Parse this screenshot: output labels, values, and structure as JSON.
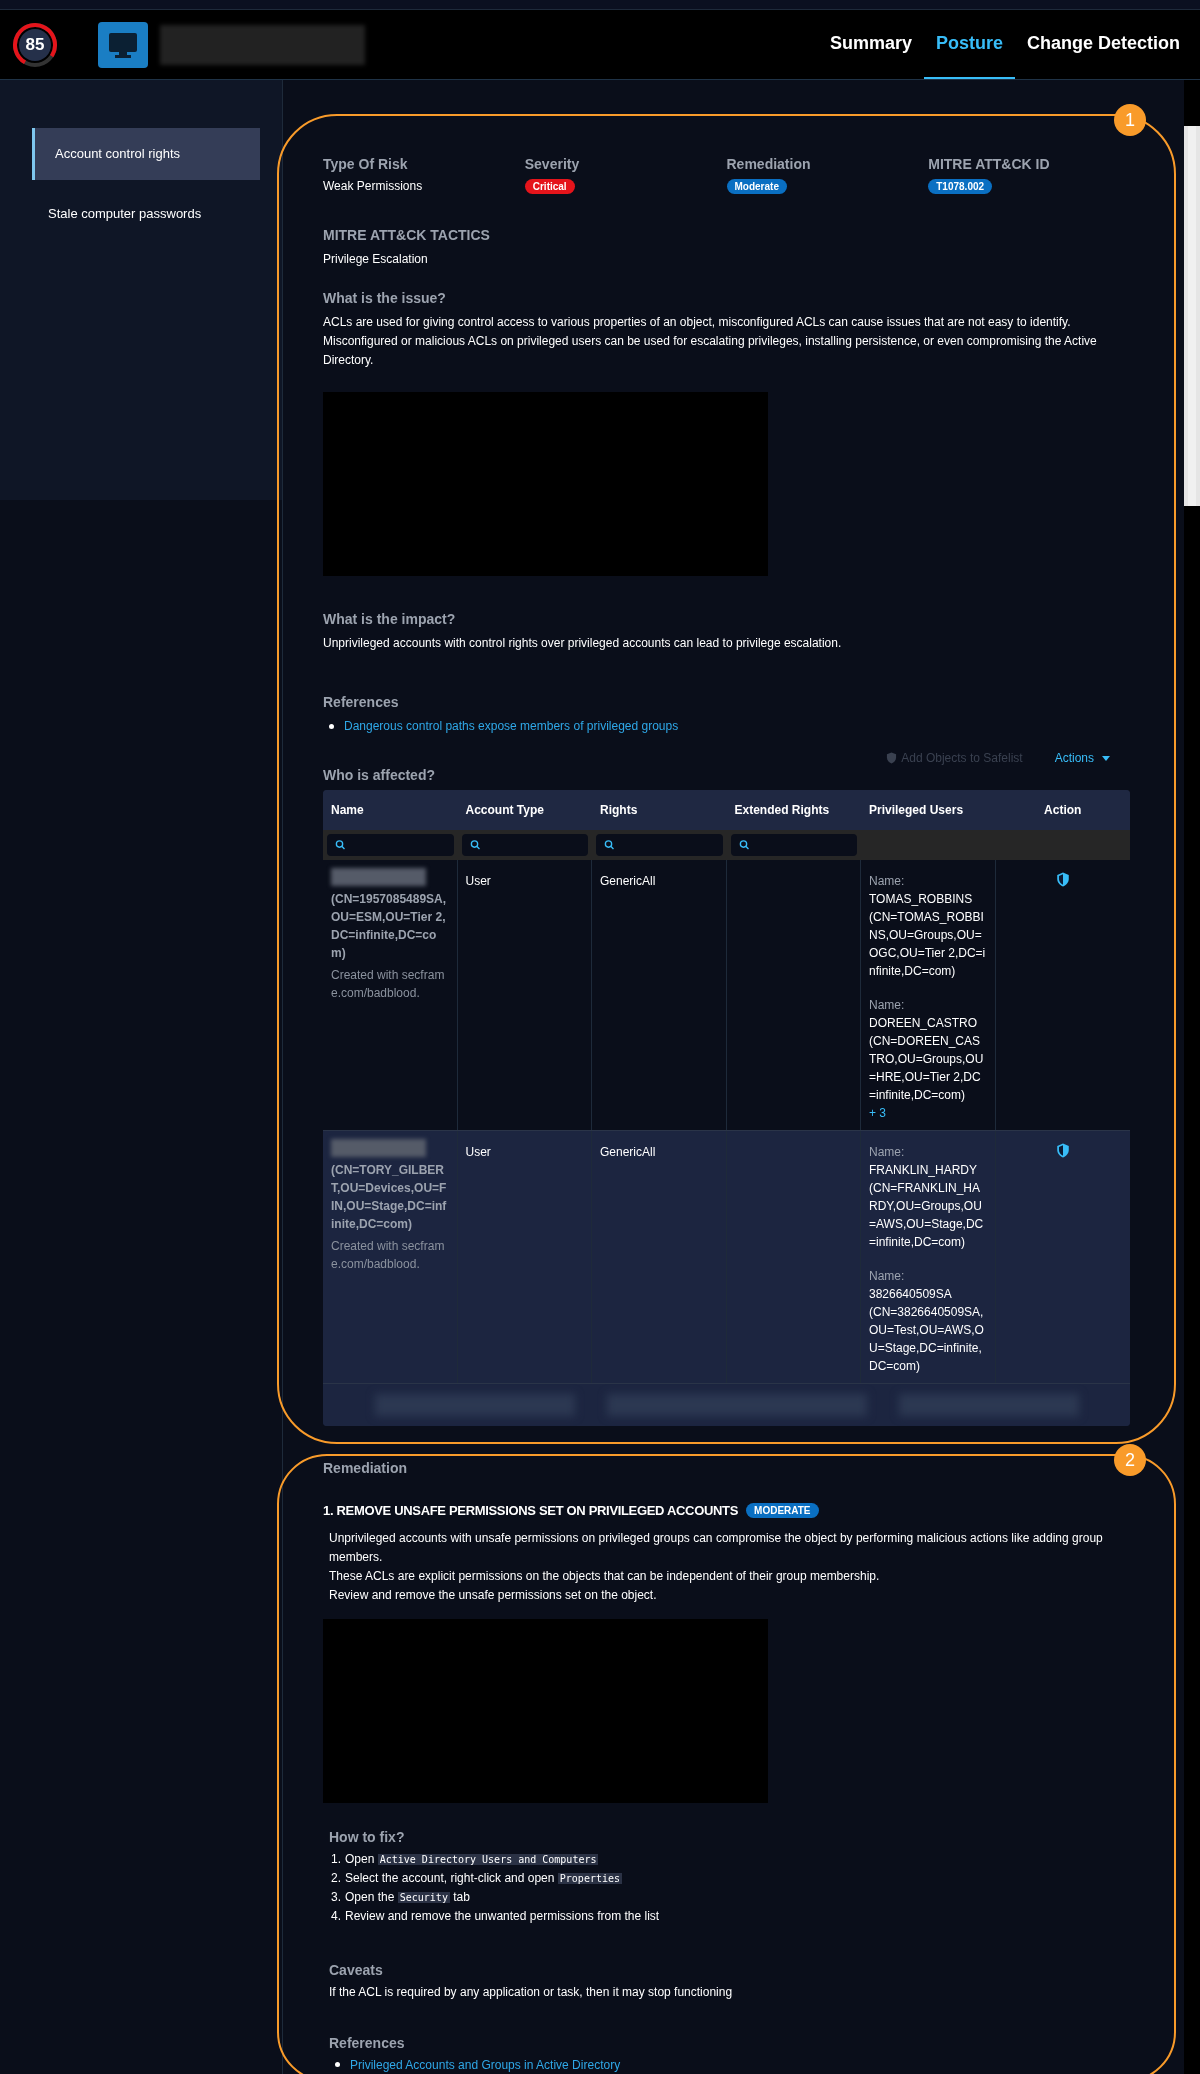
{
  "header": {
    "score": "85",
    "tabs": [
      {
        "label": "Summary",
        "selected": false
      },
      {
        "label": "Posture",
        "selected": true
      },
      {
        "label": "Change Detection",
        "selected": false
      }
    ]
  },
  "sidebar": {
    "items": [
      {
        "label": "Account control rights",
        "selected": true
      },
      {
        "label": "Stale computer passwords",
        "selected": false
      }
    ]
  },
  "annotations": [
    "1",
    "2"
  ],
  "risk": {
    "fields": [
      {
        "label": "Type Of Risk",
        "value": "Weak Permissions",
        "kind": "text"
      },
      {
        "label": "Severity",
        "value": "Critical",
        "kind": "badge",
        "color": "#e5141b"
      },
      {
        "label": "Remediation",
        "value": "Moderate",
        "kind": "badge",
        "color": "#0a6fc2"
      },
      {
        "label": "MITRE ATT&CK ID",
        "value": "T1078.002",
        "kind": "badge",
        "color": "#0a6fc2"
      }
    ],
    "tactics_label": "MITRE ATT&CK TACTICS",
    "tactics": "Privilege Escalation",
    "issue_heading": "What is the issue?",
    "issue_text": [
      "ACLs are used for giving control access to various properties of an object, misconfigured ACLs can cause issues that are not easy to identify.",
      "Misconfigured or malicious ACLs on privileged users can be used for escalating privileges, installing persistence, or even compromising the Active Directory."
    ],
    "impact_heading": "What is the impact?",
    "impact_text": "Unprivileged accounts with control rights over privileged accounts can lead to privilege escalation.",
    "references_heading": "References",
    "references": [
      "Dangerous control paths expose members of privileged groups"
    ]
  },
  "affected": {
    "safelist_button": {
      "label": "Add Objects to Safelist",
      "disabled": true
    },
    "actions_button": "Actions",
    "heading": "Who is affected?",
    "columns": [
      {
        "label": "Name",
        "filter": true
      },
      {
        "label": "Account Type",
        "filter": true
      },
      {
        "label": "Rights",
        "filter": true
      },
      {
        "label": "Extended Rights",
        "filter": true
      },
      {
        "label": "Privileged Users",
        "filter": false
      },
      {
        "label": "Action",
        "filter": false
      }
    ],
    "rows": [
      {
        "selected": false,
        "dn": "(CN=1957085489SA,OU=ESM,OU=Tier 2,DC=infinite,DC=com)",
        "note": "Created with secframe.com/badblood.",
        "account_type": "User",
        "rights": "GenericAll",
        "privileged_users": [
          {
            "label": "Name:",
            "name": "TOMAS_ROBBINS",
            "dn": "(CN=TOMAS_ROBBINS,OU=Groups,OU=OGC,OU=Tier 2,DC=infinite,DC=com)"
          },
          {
            "label": "Name:",
            "name": "DOREEN_CASTRO",
            "dn": "(CN=DOREEN_CASTRO,OU=Groups,OU=HRE,OU=Tier 2,DC=infinite,DC=com)"
          }
        ],
        "more": "+ 3"
      },
      {
        "selected": true,
        "dn": "(CN=TORY_GILBERT,OU=Devices,OU=FIN,OU=Stage,DC=infinite,DC=com)",
        "note": "Created with secframe.com/badblood.",
        "account_type": "User",
        "rights": "GenericAll",
        "privileged_users": [
          {
            "label": "Name:",
            "name": "FRANKLIN_HARDY",
            "dn": "(CN=FRANKLIN_HARDY,OU=Groups,OU=AWS,OU=Stage,DC=infinite,DC=com)"
          },
          {
            "label": "Name:",
            "name": "3826640509SA",
            "dn": "(CN=3826640509SA,OU=Test,OU=AWS,OU=Stage,DC=infinite,DC=com)"
          }
        ]
      }
    ]
  },
  "remediation": {
    "heading": "Remediation",
    "title": "1. REMOVE UNSAFE PERMISSIONS SET ON PRIVILEGED ACCOUNTS",
    "badge": "MODERATE",
    "paragraphs": [
      "Unprivileged accounts with unsafe permissions on privileged groups can compromise the object by performing malicious actions like adding group members.",
      "These ACLs are explicit permissions on the objects that can be independent of their group membership.",
      "Review and remove the unsafe permissions set on the object."
    ],
    "how_heading": "How to fix?",
    "steps": [
      {
        "number": "1.",
        "parts": [
          {
            "kind": "text",
            "text": "Open "
          },
          {
            "kind": "code",
            "text": "Active Directory Users and Computers"
          }
        ]
      },
      {
        "number": "2.",
        "parts": [
          {
            "kind": "text",
            "text": "Select the account, right-click and open "
          },
          {
            "kind": "code",
            "text": "Properties"
          }
        ]
      },
      {
        "number": "3.",
        "parts": [
          {
            "kind": "text",
            "text": "Open the "
          },
          {
            "kind": "code",
            "text": "Security"
          },
          {
            "kind": "text",
            "text": " tab"
          }
        ]
      },
      {
        "number": "4.",
        "parts": [
          {
            "kind": "text",
            "text": "Review and remove the unwanted permissions from the list"
          }
        ]
      }
    ],
    "caveats_heading": "Caveats",
    "caveats": "If the ACL is required by any application or task, then it may stop functioning",
    "references_heading": "References",
    "references": [
      "Privileged Accounts and Groups in Active Directory"
    ]
  }
}
